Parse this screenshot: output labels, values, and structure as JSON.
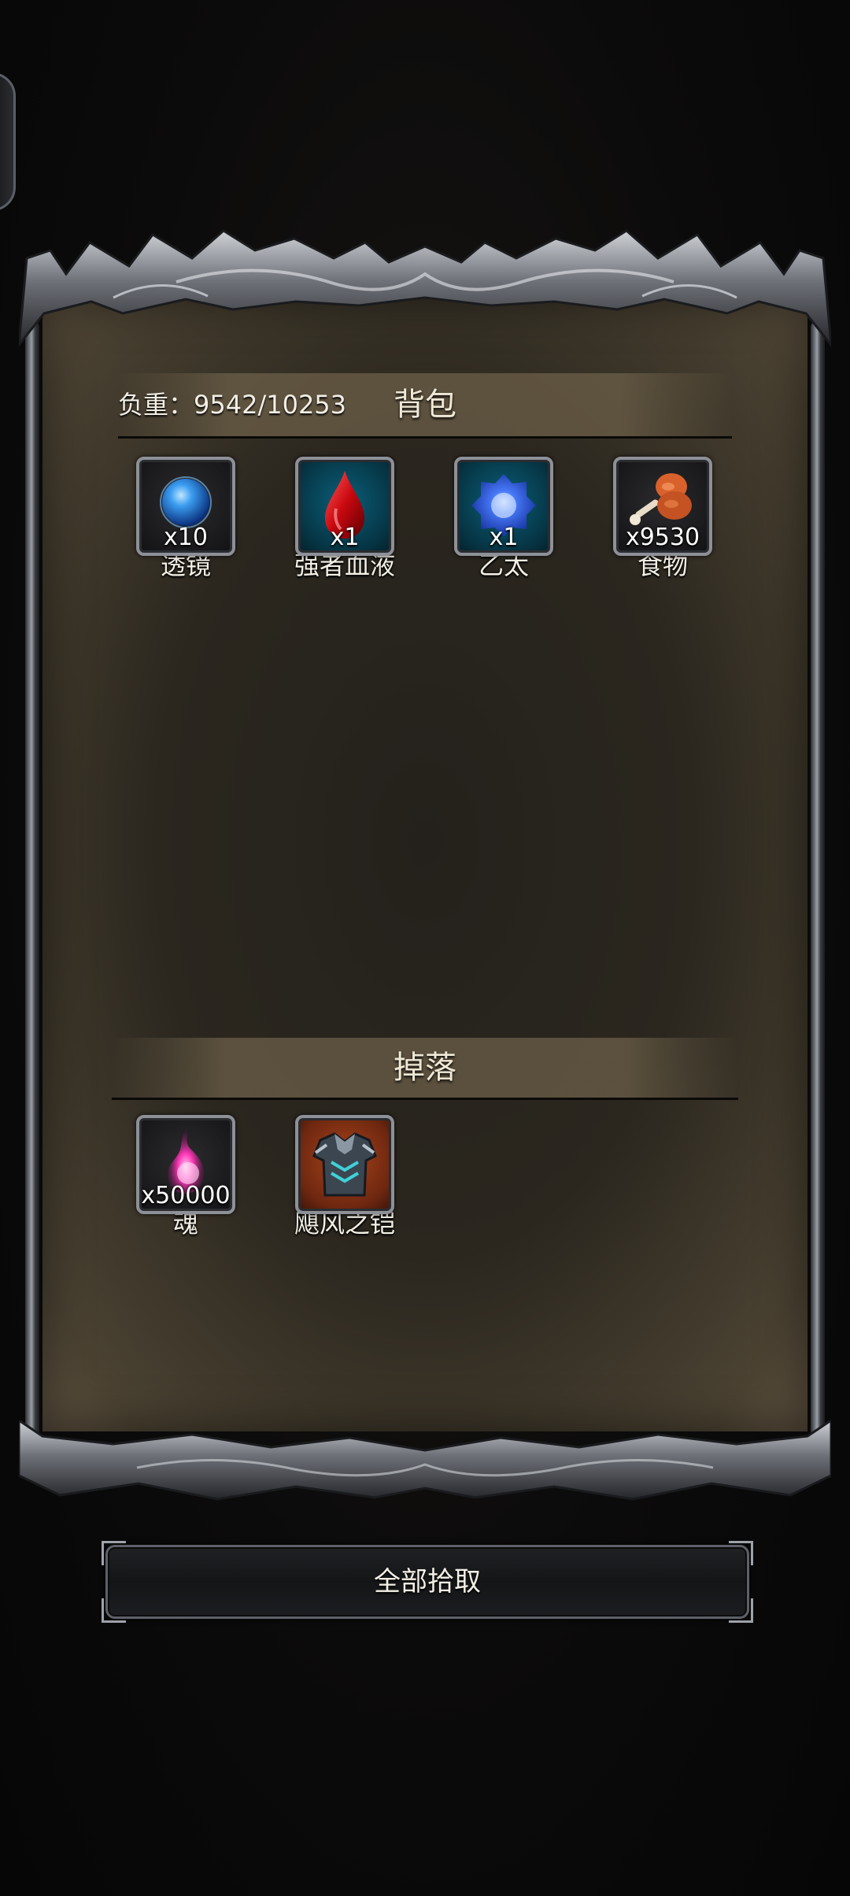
{
  "backpack": {
    "title": "背包",
    "weight_text": "负重：9542/10253",
    "items": [
      {
        "name": "透镜",
        "count": "x10",
        "icon": "blue-orb-icon",
        "slot_color": "#222327"
      },
      {
        "name": "强者血液",
        "count": "x1",
        "icon": "blood-drop-icon",
        "slot_color": "#063646"
      },
      {
        "name": "乙太",
        "count": "x1",
        "icon": "ether-orb-icon",
        "slot_color": "#063646"
      },
      {
        "name": "食物",
        "count": "x9530",
        "icon": "meat-drumstick-icon",
        "slot_color": "#222327"
      }
    ]
  },
  "drops": {
    "title": "掉落",
    "items": [
      {
        "name": "魂",
        "count": "x50000",
        "icon": "pink-soul-icon",
        "slot_color": "#1a1a1c"
      },
      {
        "name": "飓风之铠",
        "count": "",
        "icon": "armor-icon",
        "slot_color": "#6e2710"
      }
    ]
  },
  "actions": {
    "pickup_all_label": "全部拾取"
  },
  "colors": {
    "frame_metal": "#8d9097",
    "parchment": "#2b271f",
    "header_band": "#6c5f48",
    "text": "#f1ece1"
  }
}
